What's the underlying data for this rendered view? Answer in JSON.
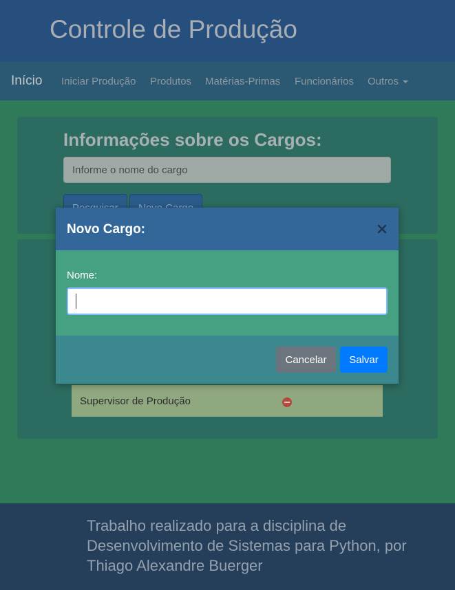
{
  "header": {
    "title": "Controle de Produção"
  },
  "navbar": {
    "brand": "Início",
    "links": [
      "Iniciar Produção",
      "Produtos",
      "Matérias-Primas",
      "Funcionários",
      "Outros"
    ]
  },
  "search_section": {
    "title": "Informações sobre os Cargos:",
    "input_placeholder": "Informe o nome do cargo",
    "search_button": "Pesquisar",
    "new_button": "Novo Cargo"
  },
  "cargo_list": {
    "items": [
      {
        "label": "Supervisor de Produção"
      }
    ]
  },
  "modal": {
    "title": "Novo Cargo:",
    "field_label": "Nome:",
    "field_value": "",
    "cancel_label": "Cancelar",
    "save_label": "Salvar"
  },
  "footer": {
    "text": "Trabalho realizado para a disciplina de Desenvolvimento de Sistemas para Python, por Thiago Alexandre Buerger"
  },
  "colors": {
    "modal_header": "#336699",
    "modal_body": "#46a183",
    "modal_footer": "#3b898e",
    "cancel_button": "#6c757d",
    "save_button": "#007bff"
  }
}
